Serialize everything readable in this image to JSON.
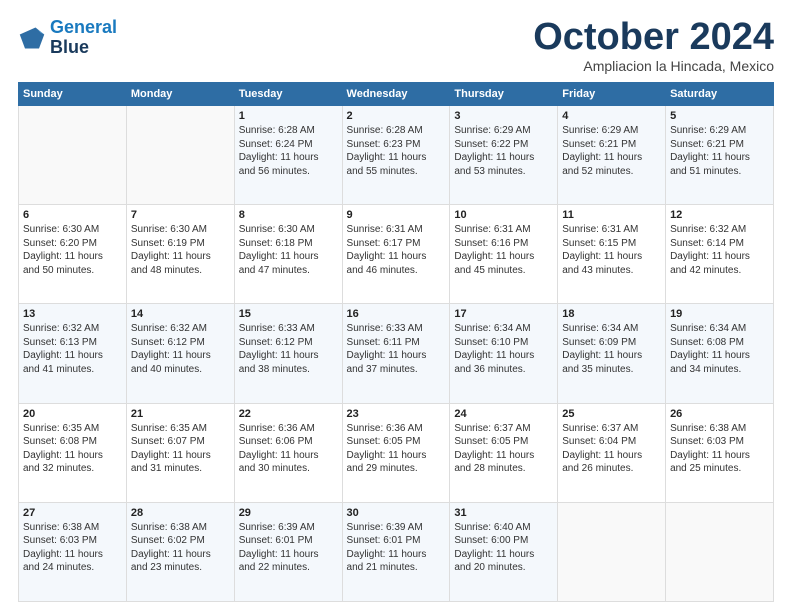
{
  "logo": {
    "line1": "General",
    "line2": "Blue"
  },
  "title": "October 2024",
  "subtitle": "Ampliacion la Hincada, Mexico",
  "header_days": [
    "Sunday",
    "Monday",
    "Tuesday",
    "Wednesday",
    "Thursday",
    "Friday",
    "Saturday"
  ],
  "weeks": [
    [
      {
        "day": "",
        "info": ""
      },
      {
        "day": "",
        "info": ""
      },
      {
        "day": "1",
        "info": "Sunrise: 6:28 AM\nSunset: 6:24 PM\nDaylight: 11 hours\nand 56 minutes."
      },
      {
        "day": "2",
        "info": "Sunrise: 6:28 AM\nSunset: 6:23 PM\nDaylight: 11 hours\nand 55 minutes."
      },
      {
        "day": "3",
        "info": "Sunrise: 6:29 AM\nSunset: 6:22 PM\nDaylight: 11 hours\nand 53 minutes."
      },
      {
        "day": "4",
        "info": "Sunrise: 6:29 AM\nSunset: 6:21 PM\nDaylight: 11 hours\nand 52 minutes."
      },
      {
        "day": "5",
        "info": "Sunrise: 6:29 AM\nSunset: 6:21 PM\nDaylight: 11 hours\nand 51 minutes."
      }
    ],
    [
      {
        "day": "6",
        "info": "Sunrise: 6:30 AM\nSunset: 6:20 PM\nDaylight: 11 hours\nand 50 minutes."
      },
      {
        "day": "7",
        "info": "Sunrise: 6:30 AM\nSunset: 6:19 PM\nDaylight: 11 hours\nand 48 minutes."
      },
      {
        "day": "8",
        "info": "Sunrise: 6:30 AM\nSunset: 6:18 PM\nDaylight: 11 hours\nand 47 minutes."
      },
      {
        "day": "9",
        "info": "Sunrise: 6:31 AM\nSunset: 6:17 PM\nDaylight: 11 hours\nand 46 minutes."
      },
      {
        "day": "10",
        "info": "Sunrise: 6:31 AM\nSunset: 6:16 PM\nDaylight: 11 hours\nand 45 minutes."
      },
      {
        "day": "11",
        "info": "Sunrise: 6:31 AM\nSunset: 6:15 PM\nDaylight: 11 hours\nand 43 minutes."
      },
      {
        "day": "12",
        "info": "Sunrise: 6:32 AM\nSunset: 6:14 PM\nDaylight: 11 hours\nand 42 minutes."
      }
    ],
    [
      {
        "day": "13",
        "info": "Sunrise: 6:32 AM\nSunset: 6:13 PM\nDaylight: 11 hours\nand 41 minutes."
      },
      {
        "day": "14",
        "info": "Sunrise: 6:32 AM\nSunset: 6:12 PM\nDaylight: 11 hours\nand 40 minutes."
      },
      {
        "day": "15",
        "info": "Sunrise: 6:33 AM\nSunset: 6:12 PM\nDaylight: 11 hours\nand 38 minutes."
      },
      {
        "day": "16",
        "info": "Sunrise: 6:33 AM\nSunset: 6:11 PM\nDaylight: 11 hours\nand 37 minutes."
      },
      {
        "day": "17",
        "info": "Sunrise: 6:34 AM\nSunset: 6:10 PM\nDaylight: 11 hours\nand 36 minutes."
      },
      {
        "day": "18",
        "info": "Sunrise: 6:34 AM\nSunset: 6:09 PM\nDaylight: 11 hours\nand 35 minutes."
      },
      {
        "day": "19",
        "info": "Sunrise: 6:34 AM\nSunset: 6:08 PM\nDaylight: 11 hours\nand 34 minutes."
      }
    ],
    [
      {
        "day": "20",
        "info": "Sunrise: 6:35 AM\nSunset: 6:08 PM\nDaylight: 11 hours\nand 32 minutes."
      },
      {
        "day": "21",
        "info": "Sunrise: 6:35 AM\nSunset: 6:07 PM\nDaylight: 11 hours\nand 31 minutes."
      },
      {
        "day": "22",
        "info": "Sunrise: 6:36 AM\nSunset: 6:06 PM\nDaylight: 11 hours\nand 30 minutes."
      },
      {
        "day": "23",
        "info": "Sunrise: 6:36 AM\nSunset: 6:05 PM\nDaylight: 11 hours\nand 29 minutes."
      },
      {
        "day": "24",
        "info": "Sunrise: 6:37 AM\nSunset: 6:05 PM\nDaylight: 11 hours\nand 28 minutes."
      },
      {
        "day": "25",
        "info": "Sunrise: 6:37 AM\nSunset: 6:04 PM\nDaylight: 11 hours\nand 26 minutes."
      },
      {
        "day": "26",
        "info": "Sunrise: 6:38 AM\nSunset: 6:03 PM\nDaylight: 11 hours\nand 25 minutes."
      }
    ],
    [
      {
        "day": "27",
        "info": "Sunrise: 6:38 AM\nSunset: 6:03 PM\nDaylight: 11 hours\nand 24 minutes."
      },
      {
        "day": "28",
        "info": "Sunrise: 6:38 AM\nSunset: 6:02 PM\nDaylight: 11 hours\nand 23 minutes."
      },
      {
        "day": "29",
        "info": "Sunrise: 6:39 AM\nSunset: 6:01 PM\nDaylight: 11 hours\nand 22 minutes."
      },
      {
        "day": "30",
        "info": "Sunrise: 6:39 AM\nSunset: 6:01 PM\nDaylight: 11 hours\nand 21 minutes."
      },
      {
        "day": "31",
        "info": "Sunrise: 6:40 AM\nSunset: 6:00 PM\nDaylight: 11 hours\nand 20 minutes."
      },
      {
        "day": "",
        "info": ""
      },
      {
        "day": "",
        "info": ""
      }
    ]
  ]
}
